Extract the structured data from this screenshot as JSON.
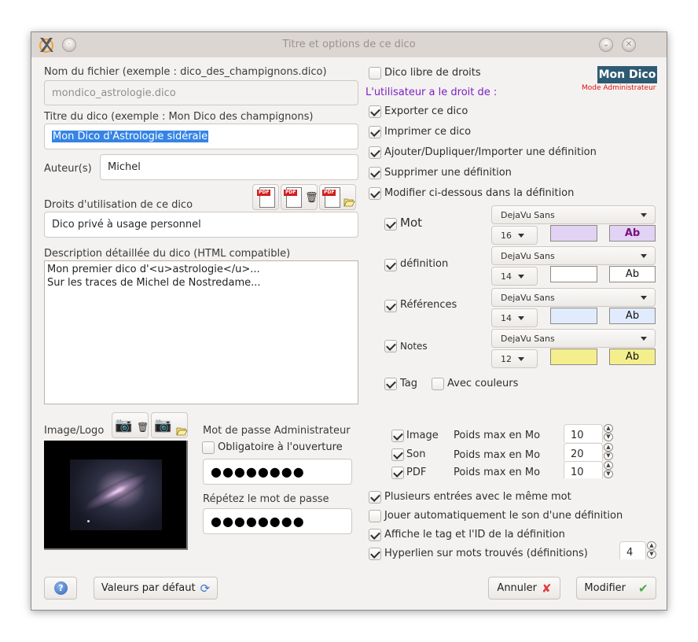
{
  "window": {
    "title": "Titre et options de ce dico",
    "icons": [
      "app-x-icon",
      "minimize-icon",
      "shade-icon",
      "close-icon"
    ]
  },
  "left": {
    "filename": {
      "label": "Nom du fichier (exemple : dico_des_champignons.dico)",
      "value": "mondico_astrologie.dico"
    },
    "title": {
      "label": "Titre du dico (exemple : Mon Dico des champignons)",
      "value": "Mon Dico d'Astrologie sidérale"
    },
    "authors": {
      "label": "Auteur(s)",
      "value": "Michel"
    },
    "rights": {
      "label": "Droits d'utilisation de ce dico",
      "value": "Dico privé à usage personnel",
      "pdf_buttons": [
        "pdf-view-icon",
        "pdf-delete-icon",
        "pdf-open-icon"
      ]
    },
    "description": {
      "label": "Description détaillée du dico (HTML compatible)",
      "lines": [
        "Mon premier dico d'<u>astrologie</u>...",
        "Sur les traces de Michel de Nostredame..."
      ]
    },
    "image": {
      "label": "Image/Logo",
      "buttons": [
        "camera-delete-icon",
        "camera-open-icon"
      ]
    },
    "password": {
      "label": "Mot de passe Administrateur",
      "mandatory_label": "Obligatoire à l'ouverture",
      "mandatory_checked": false,
      "value": "●●●●●●●●",
      "repeat_label": "Répétez le mot de passe",
      "repeat_value": "●●●●●●●●"
    }
  },
  "right": {
    "free_rights": {
      "label": "Dico libre de droits",
      "checked": false
    },
    "logo": {
      "text": "Mon Dico",
      "mode": "Mode Administrateur",
      "bg": "#2e5a73",
      "mode_color": "#e01010"
    },
    "user_rights_label": "L'utilisateur a le droit de :",
    "user_rights_color": "#7a1fc4",
    "permissions": [
      {
        "label": "Exporter ce dico",
        "checked": true
      },
      {
        "label": "Imprimer ce dico",
        "checked": true
      },
      {
        "label": "Ajouter/Dupliquer/Importer une définition",
        "checked": true
      },
      {
        "label": "Supprimer une définition",
        "checked": true
      },
      {
        "label": "Modifier ci-dessous dans la définition",
        "checked": true
      }
    ],
    "styles": [
      {
        "label": "Mot",
        "checked": true,
        "font": "DejaVu Sans",
        "size": "16",
        "color": "#e2d3f4",
        "sample": "Ab",
        "sample_color": "#7a0f7a",
        "sample_bold": true
      },
      {
        "label": "définition",
        "checked": true,
        "font": "DejaVu Sans",
        "size": "14",
        "color": "#ffffff",
        "sample": "Ab",
        "sample_color": "#111111",
        "sample_bold": false
      },
      {
        "label": "Références",
        "checked": true,
        "font": "DejaVu Sans",
        "size": "14",
        "color": "#e0ecfd",
        "sample": "Ab",
        "sample_color": "#111111",
        "sample_bold": false
      },
      {
        "label": "Notes",
        "checked": true,
        "font": "DejaVu Sans",
        "size": "12",
        "color": "#f4ef8c",
        "sample": "Ab",
        "sample_color": "#111111",
        "sample_bold": false
      }
    ],
    "tag": {
      "label": "Tag",
      "checked": true
    },
    "with_colors": {
      "label": "Avec couleurs",
      "checked": false
    },
    "media": [
      {
        "label": "Image",
        "checked": true,
        "weight_label": "Poids max en Mo",
        "value": "10"
      },
      {
        "label": "Son",
        "checked": true,
        "weight_label": "Poids max en Mo",
        "value": "20"
      },
      {
        "label": "PDF",
        "checked": true,
        "weight_label": "Poids max en Mo",
        "value": "10"
      }
    ],
    "options": [
      {
        "label": "Plusieurs entrées avec le même mot",
        "checked": true
      },
      {
        "label": "Jouer automatiquement le son d'une définition",
        "checked": false
      },
      {
        "label": "Affiche le tag et l'ID de la définition",
        "checked": true
      },
      {
        "label": "Hyperlien sur mots trouvés (définitions)",
        "checked": true
      }
    ],
    "hyperlink_count": "4"
  },
  "footer": {
    "help_icon": "help-icon",
    "defaults_label": "Valeurs par défaut",
    "cancel_label": "Annuler",
    "modify_label": "Modifier"
  }
}
